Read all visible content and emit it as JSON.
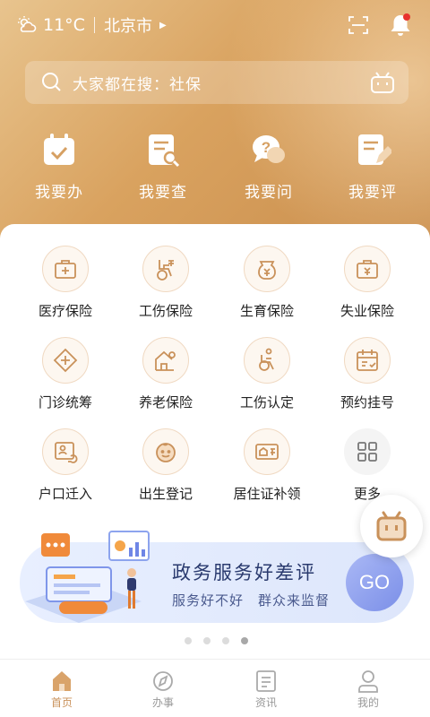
{
  "status": {
    "temperature": "11°C",
    "city": "北京市",
    "weather_icon": "partly-cloudy-icon"
  },
  "search": {
    "placeholder": "大家都在搜：社保"
  },
  "quick_actions": [
    {
      "label": "我要办",
      "icon": "calendar-check-icon"
    },
    {
      "label": "我要查",
      "icon": "document-search-icon"
    },
    {
      "label": "我要问",
      "icon": "question-chat-icon"
    },
    {
      "label": "我要评",
      "icon": "document-edit-icon"
    }
  ],
  "services": [
    {
      "label": "医疗保险",
      "icon": "medical-kit-icon"
    },
    {
      "label": "工伤保险",
      "icon": "wheelchair-insurance-icon"
    },
    {
      "label": "生育保险",
      "icon": "maternity-bottle-icon"
    },
    {
      "label": "失业保险",
      "icon": "unemployment-box-icon"
    },
    {
      "label": "门诊统筹",
      "icon": "clinic-diamond-icon"
    },
    {
      "label": "养老保险",
      "icon": "elderly-house-icon"
    },
    {
      "label": "工伤认定",
      "icon": "wheelchair-icon"
    },
    {
      "label": "预约挂号",
      "icon": "calendar-appointment-icon"
    },
    {
      "label": "户口迁入",
      "icon": "household-card-icon"
    },
    {
      "label": "出生登记",
      "icon": "baby-face-icon"
    },
    {
      "label": "居住证补领",
      "icon": "residence-card-icon"
    },
    {
      "label": "更多",
      "icon": "more-grid-icon"
    }
  ],
  "banner": {
    "title": "政务服务好差评",
    "subtitle": "服务好不好　群众来监督",
    "button": "GO"
  },
  "tabs": [
    {
      "label": "首页",
      "icon": "home-icon",
      "active": true
    },
    {
      "label": "办事",
      "icon": "compass-icon",
      "active": false
    },
    {
      "label": "资讯",
      "icon": "news-icon",
      "active": false
    },
    {
      "label": "我的",
      "icon": "user-icon",
      "active": false
    }
  ],
  "colors": {
    "accent": "#c9915a",
    "hero_start": "#e8c48e",
    "hero_end": "#c98d4c"
  }
}
